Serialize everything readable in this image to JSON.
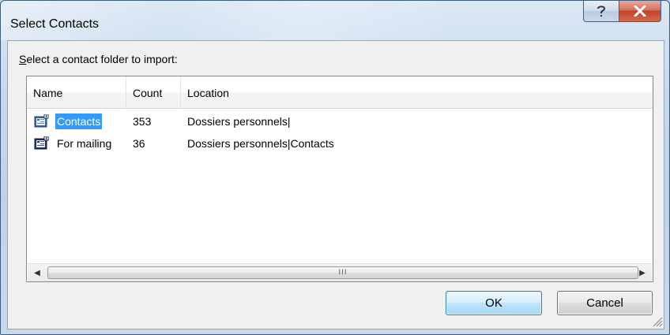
{
  "window": {
    "title": "Select Contacts",
    "help_icon": "help-question-icon",
    "close_icon": "close-x-icon"
  },
  "prompt": {
    "accel": "S",
    "rest": "elect a contact folder to import:"
  },
  "list": {
    "columns": [
      "Name",
      "Count",
      "Location"
    ],
    "rows": [
      {
        "name": "Contacts",
        "count": "353",
        "location": "Dossiers personnels|",
        "icon": "contact-folder-icon",
        "selected": true
      },
      {
        "name": "For mailing",
        "count": "36",
        "location": "Dossiers personnels|Contacts",
        "icon": "contact-folder-icon",
        "selected": false
      }
    ],
    "scroll_grip": "III"
  },
  "buttons": {
    "ok": "OK",
    "cancel": "Cancel"
  },
  "colors": {
    "selection": "#3399ff",
    "close_button": "#c2412a",
    "ok_border": "#3c7fb1"
  }
}
